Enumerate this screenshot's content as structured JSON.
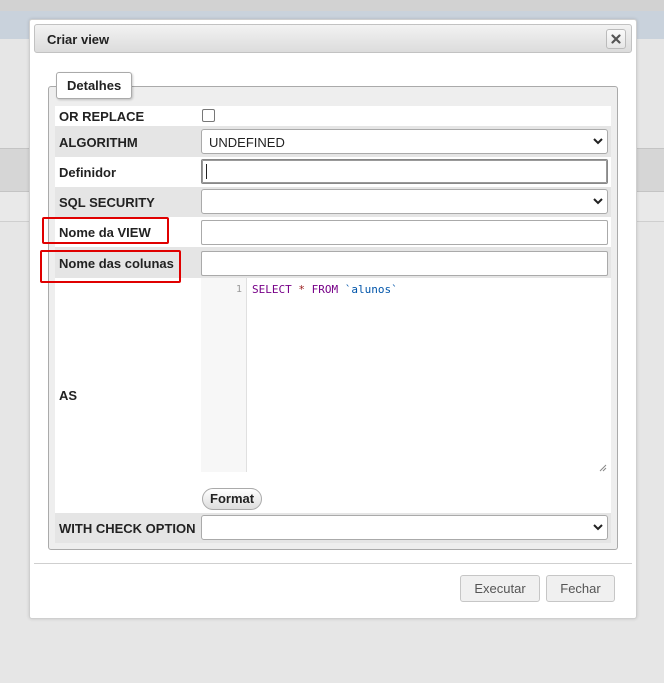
{
  "dialog": {
    "title": "Criar view",
    "tab_label": "Detalhes",
    "fields": {
      "or_replace": {
        "label": "OR REPLACE",
        "checked": false
      },
      "algorithm": {
        "label": "ALGORITHM",
        "value": "UNDEFINED"
      },
      "definer": {
        "label": "Definidor",
        "value": ""
      },
      "sql_security": {
        "label": "SQL SECURITY",
        "value": ""
      },
      "view_name": {
        "label": "Nome da VIEW",
        "value": ""
      },
      "column_names": {
        "label": "Nome das colunas",
        "value": ""
      },
      "as": {
        "label": "AS",
        "line_number": "1",
        "code_select": "SELECT",
        "code_star": "*",
        "code_from": "FROM",
        "code_table": "`alunos`"
      },
      "with_check_option": {
        "label": "WITH CHECK OPTION",
        "value": ""
      }
    },
    "format_label": "Format",
    "buttons": {
      "execute": "Executar",
      "close": "Fechar"
    }
  },
  "colors": {
    "highlight": "#e00000",
    "keyword": "#770088",
    "string": "#0055aa"
  }
}
